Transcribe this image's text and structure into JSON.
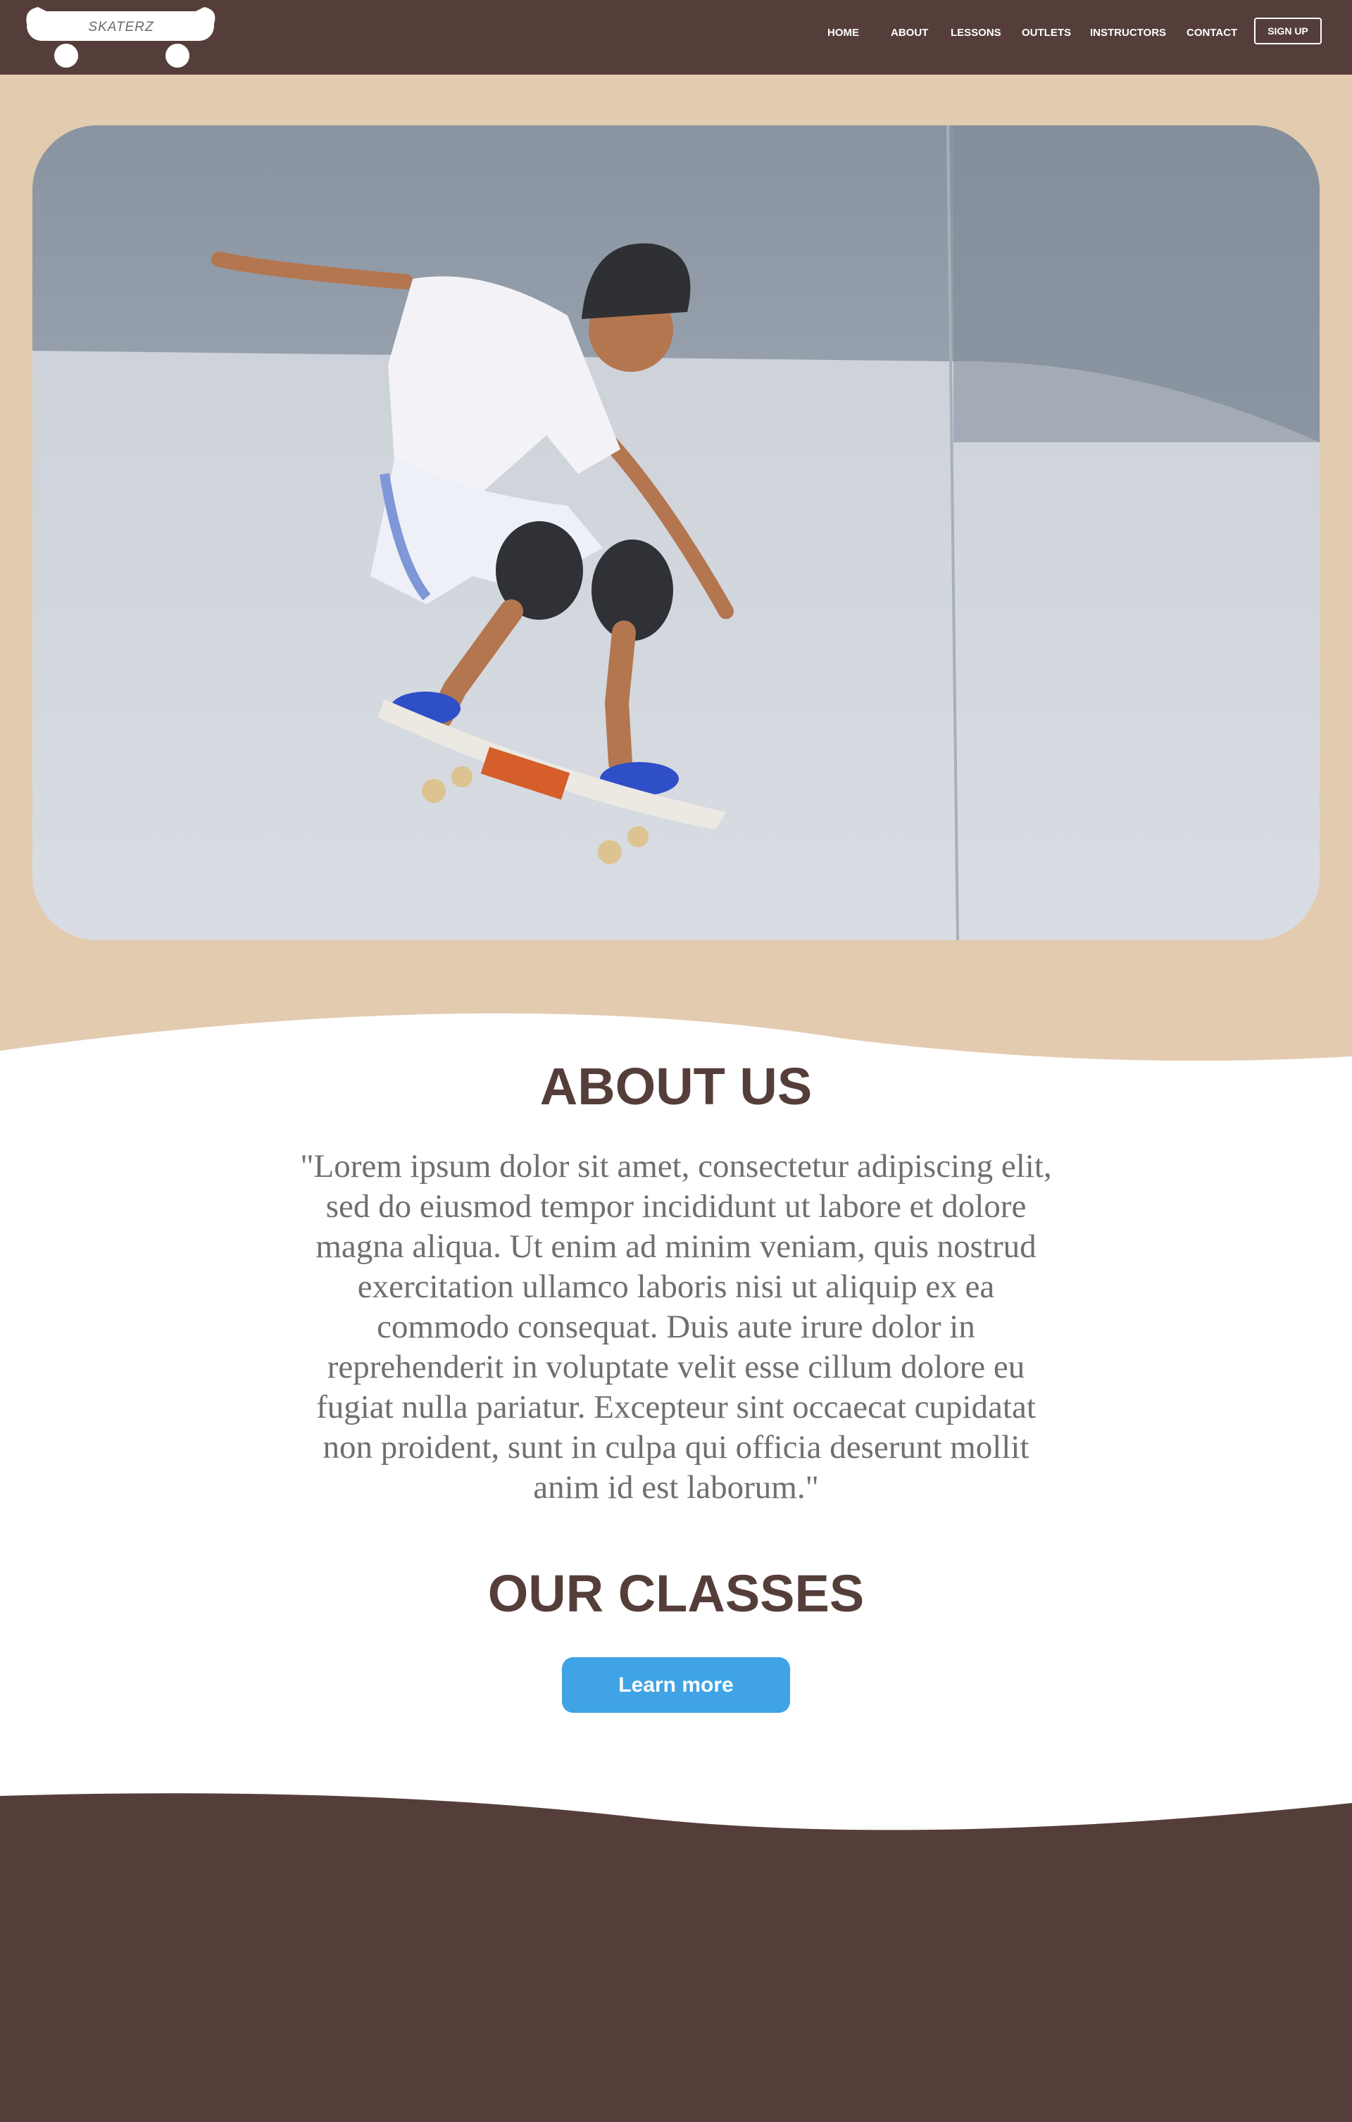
{
  "brand": {
    "name": "SKATERZ"
  },
  "nav": {
    "items": [
      {
        "label": "HOME"
      },
      {
        "label": "ABOUT"
      },
      {
        "label": "LESSONS"
      },
      {
        "label": "OUTLETS"
      },
      {
        "label": "INSTRUCTORS"
      },
      {
        "label": "CONTACT"
      }
    ],
    "signup_label": "SIGN UP"
  },
  "about": {
    "title": "ABOUT US",
    "text": "\"Lorem ipsum dolor sit amet, consectetur adipiscing elit, sed do eiusmod tempor incididunt ut labore et dolore magna aliqua. Ut enim ad minim veniam, quis nostrud exercitation ullamco laboris nisi ut aliquip ex ea commodo consequat. Duis aute irure dolor in reprehenderit in voluptate velit esse cillum dolore eu fugiat nulla pariatur. Excepteur sint occaecat cupidatat non proident, sunt in culpa qui officia deserunt mollit anim id est laborum.\""
  },
  "classes": {
    "title": "OUR CLASSES",
    "button_label": "Learn more"
  },
  "colors": {
    "navbar": "#553e3a",
    "hero_background": "#e3cbb0",
    "heading": "#553e3a",
    "body_text": "#6f6f6f",
    "button": "#40a3e6",
    "footer": "#553e3a"
  }
}
